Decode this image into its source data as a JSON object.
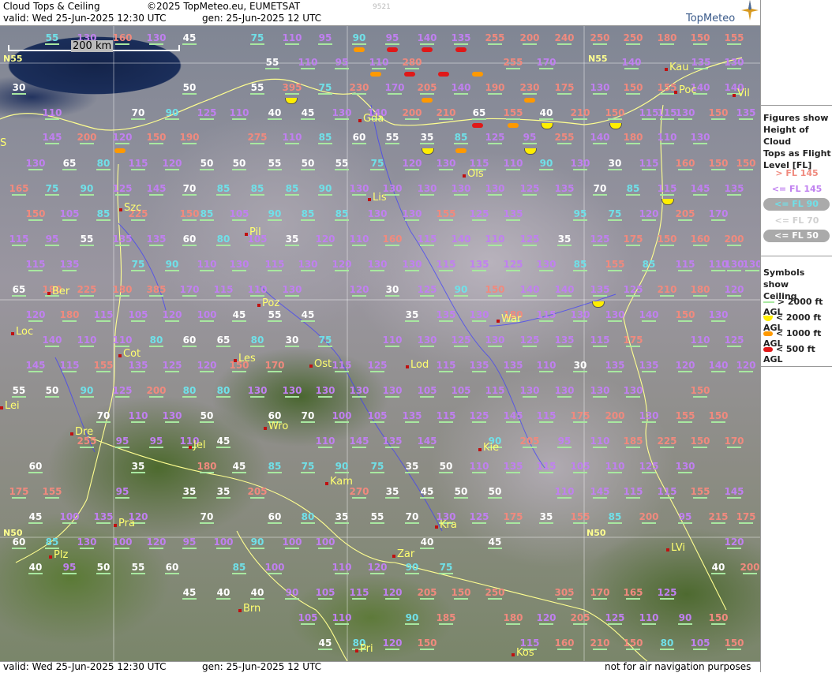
{
  "header": {
    "title": "Cloud Tops & Ceiling",
    "copyright": "©2025 TopMeteo.eu, EUMETSAT",
    "valid": "valid:  Wed  25-Jun-2025  12:30 UTC",
    "gen": "gen:  25-Jun-2025 12 UTC",
    "code": "9521",
    "logo": "TopMeteo"
  },
  "footer": {
    "valid": "valid:  Wed  25-Jun-2025  12:30 UTC",
    "gen": "gen:  25-Jun-2025 12 UTC",
    "disclaimer": "not for air navigation purposes"
  },
  "scale": "200 km",
  "colors": {
    "pink": "#f08a7e",
    "violet": "#c080f0",
    "cyan": "#70e0e8",
    "white": "#ffffff",
    "green_ok": "#a8e8a0",
    "yellow": "#ffee00",
    "orange": "#ff9900",
    "red": "#e01818"
  },
  "legend": {
    "figures_title": [
      "Figures show",
      "Height of Cloud",
      "Tops as Flight",
      "Level  [FL]"
    ],
    "items": [
      {
        "text": "> FL 145",
        "color": "#f08a7e",
        "style": "plain"
      },
      {
        "text": "<= FL 145",
        "color": "#c080f0",
        "style": "plain"
      },
      {
        "text": "<= FL 90",
        "color": "#70e0e8",
        "style": "pill"
      },
      {
        "text": "<= FL 70",
        "color": "#e8e8e8",
        "style": "plain"
      },
      {
        "text": "<= FL 50",
        "color": "#ffffff",
        "style": "pill"
      }
    ],
    "symbols_title": [
      "Symbols show",
      "Ceiling"
    ],
    "symbols": [
      {
        "text": "> 2000 ft AGL",
        "kind": "line"
      },
      {
        "text": "< 2000 ft AGL",
        "kind": "yellow"
      },
      {
        "text": "< 1000 ft AGL",
        "kind": "orange"
      },
      {
        "text": "< 500 ft AGL",
        "kind": "red"
      }
    ]
  },
  "latitudes": [
    "N55",
    "N55",
    "N50",
    "N50"
  ],
  "cities": [
    "Kau",
    "Poc",
    "Vil",
    "Gda",
    "Ols",
    "Lis",
    "Szc",
    "Pil",
    "Ber",
    "Poz",
    "War",
    "Loc",
    "Cot",
    "Les",
    "Ost",
    "Lod",
    "Lei",
    "Dre",
    "Wro",
    "Jel",
    "Kie",
    "Kam",
    "Pra",
    "Kra",
    "Plz",
    "Zar",
    "LVi",
    "Brn",
    "Pri",
    "Kos",
    "S"
  ],
  "values": [
    [
      "55",
      "c"
    ],
    [
      "130",
      "v"
    ],
    [
      "160",
      "p"
    ],
    [
      "130",
      "v"
    ],
    [
      "45",
      "w"
    ],
    [
      "75",
      "c"
    ],
    [
      "110",
      "v"
    ],
    [
      "95",
      "v"
    ],
    [
      "90",
      "c"
    ],
    [
      "95",
      "v"
    ],
    [
      "140",
      "v"
    ],
    [
      "135",
      "v"
    ],
    [
      "255",
      "p"
    ],
    [
      "200",
      "p"
    ],
    [
      "240",
      "p"
    ],
    [
      "250",
      "p"
    ],
    [
      "250",
      "p"
    ],
    [
      "180",
      "p"
    ],
    [
      "150",
      "p"
    ],
    [
      "155",
      "p"
    ],
    [
      "55",
      "w"
    ],
    [
      "110",
      "v"
    ],
    [
      "95",
      "v"
    ],
    [
      "110",
      "v"
    ],
    [
      "280",
      "p"
    ],
    [
      "255",
      "p"
    ],
    [
      "170",
      "v"
    ],
    [
      "140",
      "v"
    ],
    [
      "135",
      "v"
    ],
    [
      "130",
      "v"
    ],
    [
      "30",
      "w"
    ],
    [
      "50",
      "w"
    ],
    [
      "55",
      "w"
    ],
    [
      "395",
      "p"
    ],
    [
      "75",
      "c"
    ],
    [
      "230",
      "p"
    ],
    [
      "170",
      "v"
    ],
    [
      "205",
      "p"
    ],
    [
      "140",
      "v"
    ],
    [
      "190",
      "p"
    ],
    [
      "230",
      "p"
    ],
    [
      "175",
      "p"
    ],
    [
      "130",
      "v"
    ],
    [
      "150",
      "p"
    ],
    [
      "155",
      "p"
    ],
    [
      "140",
      "v"
    ],
    [
      "140",
      "v"
    ],
    [
      "110",
      "v"
    ],
    [
      "70",
      "w"
    ],
    [
      "90",
      "c"
    ],
    [
      "125",
      "v"
    ],
    [
      "110",
      "v"
    ],
    [
      "40",
      "w"
    ],
    [
      "45",
      "w"
    ],
    [
      "130",
      "v"
    ],
    [
      "140",
      "v"
    ],
    [
      "200",
      "p"
    ],
    [
      "210",
      "p"
    ],
    [
      "65",
      "w"
    ],
    [
      "155",
      "p"
    ],
    [
      "40",
      "w"
    ],
    [
      "210",
      "p"
    ],
    [
      "150",
      "p"
    ],
    [
      "115",
      "v"
    ],
    [
      "115",
      "v"
    ],
    [
      "130",
      "v"
    ],
    [
      "150",
      "p"
    ],
    [
      "135",
      "v"
    ],
    [
      "145",
      "v"
    ],
    [
      "200",
      "p"
    ],
    [
      "120",
      "v"
    ],
    [
      "150",
      "p"
    ],
    [
      "190",
      "p"
    ],
    [
      "275",
      "p"
    ],
    [
      "110",
      "v"
    ],
    [
      "85",
      "c"
    ],
    [
      "60",
      "w"
    ],
    [
      "55",
      "w"
    ],
    [
      "35",
      "w"
    ],
    [
      "85",
      "c"
    ],
    [
      "125",
      "v"
    ],
    [
      "95",
      "v"
    ],
    [
      "255",
      "p"
    ],
    [
      "140",
      "v"
    ],
    [
      "180",
      "p"
    ],
    [
      "110",
      "v"
    ],
    [
      "130",
      "v"
    ],
    [
      "130",
      "v"
    ],
    [
      "65",
      "w"
    ],
    [
      "80",
      "c"
    ],
    [
      "115",
      "v"
    ],
    [
      "120",
      "v"
    ],
    [
      "50",
      "w"
    ],
    [
      "50",
      "w"
    ],
    [
      "55",
      "w"
    ],
    [
      "50",
      "w"
    ],
    [
      "55",
      "w"
    ],
    [
      "75",
      "c"
    ],
    [
      "120",
      "v"
    ],
    [
      "130",
      "v"
    ],
    [
      "115",
      "v"
    ],
    [
      "110",
      "v"
    ],
    [
      "90",
      "c"
    ],
    [
      "130",
      "v"
    ],
    [
      "30",
      "w"
    ],
    [
      "115",
      "v"
    ],
    [
      "160",
      "p"
    ],
    [
      "150",
      "p"
    ],
    [
      "150",
      "p"
    ],
    [
      "165",
      "p"
    ],
    [
      "75",
      "c"
    ],
    [
      "90",
      "c"
    ],
    [
      "125",
      "v"
    ],
    [
      "145",
      "v"
    ],
    [
      "70",
      "w"
    ],
    [
      "85",
      "c"
    ],
    [
      "85",
      "c"
    ],
    [
      "85",
      "c"
    ],
    [
      "90",
      "c"
    ],
    [
      "130",
      "v"
    ],
    [
      "130",
      "v"
    ],
    [
      "130",
      "v"
    ],
    [
      "130",
      "v"
    ],
    [
      "130",
      "v"
    ],
    [
      "125",
      "v"
    ],
    [
      "135",
      "v"
    ],
    [
      "70",
      "w"
    ],
    [
      "85",
      "c"
    ],
    [
      "115",
      "v"
    ],
    [
      "145",
      "v"
    ],
    [
      "135",
      "v"
    ],
    [
      "150",
      "p"
    ],
    [
      "105",
      "v"
    ],
    [
      "85",
      "c"
    ],
    [
      "225",
      "p"
    ],
    [
      "150",
      "p"
    ],
    [
      "85",
      "c"
    ],
    [
      "105",
      "v"
    ],
    [
      "90",
      "c"
    ],
    [
      "85",
      "c"
    ],
    [
      "85",
      "c"
    ],
    [
      "130",
      "v"
    ],
    [
      "130",
      "v"
    ],
    [
      "155",
      "p"
    ],
    [
      "125",
      "v"
    ],
    [
      "135",
      "v"
    ],
    [
      "95",
      "c"
    ],
    [
      "75",
      "c"
    ],
    [
      "120",
      "v"
    ],
    [
      "205",
      "p"
    ],
    [
      "170",
      "v"
    ],
    [
      "115",
      "v"
    ],
    [
      "95",
      "v"
    ],
    [
      "55",
      "w"
    ],
    [
      "135",
      "v"
    ],
    [
      "135",
      "v"
    ],
    [
      "60",
      "w"
    ],
    [
      "80",
      "c"
    ],
    [
      "105",
      "v"
    ],
    [
      "35",
      "w"
    ],
    [
      "120",
      "v"
    ],
    [
      "110",
      "v"
    ],
    [
      "160",
      "p"
    ],
    [
      "115",
      "v"
    ],
    [
      "140",
      "v"
    ],
    [
      "110",
      "v"
    ],
    [
      "125",
      "v"
    ],
    [
      "35",
      "w"
    ],
    [
      "125",
      "v"
    ],
    [
      "175",
      "p"
    ],
    [
      "150",
      "p"
    ],
    [
      "160",
      "p"
    ],
    [
      "200",
      "p"
    ],
    [
      "115",
      "v"
    ],
    [
      "135",
      "v"
    ],
    [
      "75",
      "c"
    ],
    [
      "90",
      "c"
    ],
    [
      "110",
      "v"
    ],
    [
      "130",
      "v"
    ],
    [
      "115",
      "v"
    ],
    [
      "130",
      "v"
    ],
    [
      "120",
      "v"
    ],
    [
      "130",
      "v"
    ],
    [
      "130",
      "v"
    ],
    [
      "115",
      "v"
    ],
    [
      "135",
      "v"
    ],
    [
      "125",
      "v"
    ],
    [
      "130",
      "v"
    ],
    [
      "85",
      "c"
    ],
    [
      "155",
      "p"
    ],
    [
      "85",
      "c"
    ],
    [
      "115",
      "v"
    ],
    [
      "110",
      "v"
    ],
    [
      "130",
      "v"
    ],
    [
      "130",
      "v"
    ],
    [
      "65",
      "w"
    ],
    [
      "180",
      "p"
    ],
    [
      "225",
      "p"
    ],
    [
      "180",
      "p"
    ],
    [
      "385",
      "p"
    ],
    [
      "170",
      "v"
    ],
    [
      "115",
      "v"
    ],
    [
      "110",
      "v"
    ],
    [
      "130",
      "v"
    ],
    [
      "120",
      "v"
    ],
    [
      "30",
      "w"
    ],
    [
      "125",
      "v"
    ],
    [
      "90",
      "c"
    ],
    [
      "150",
      "p"
    ],
    [
      "140",
      "v"
    ],
    [
      "140",
      "v"
    ],
    [
      "135",
      "v"
    ],
    [
      "125",
      "v"
    ],
    [
      "210",
      "p"
    ],
    [
      "180",
      "p"
    ],
    [
      "120",
      "v"
    ],
    [
      "120",
      "v"
    ],
    [
      "180",
      "p"
    ],
    [
      "115",
      "v"
    ],
    [
      "105",
      "v"
    ],
    [
      "120",
      "v"
    ],
    [
      "100",
      "v"
    ],
    [
      "45",
      "w"
    ],
    [
      "55",
      "w"
    ],
    [
      "45",
      "w"
    ],
    [
      "35",
      "w"
    ],
    [
      "135",
      "v"
    ],
    [
      "130",
      "v"
    ],
    [
      "180",
      "p"
    ],
    [
      "115",
      "v"
    ],
    [
      "130",
      "v"
    ],
    [
      "130",
      "v"
    ],
    [
      "140",
      "v"
    ],
    [
      "150",
      "p"
    ],
    [
      "130",
      "v"
    ],
    [
      "140",
      "v"
    ],
    [
      "110",
      "v"
    ],
    [
      "110",
      "v"
    ],
    [
      "80",
      "c"
    ],
    [
      "60",
      "w"
    ],
    [
      "65",
      "w"
    ],
    [
      "80",
      "c"
    ],
    [
      "30",
      "w"
    ],
    [
      "75",
      "c"
    ],
    [
      "110",
      "v"
    ],
    [
      "130",
      "v"
    ],
    [
      "125",
      "v"
    ],
    [
      "130",
      "v"
    ],
    [
      "125",
      "v"
    ],
    [
      "135",
      "v"
    ],
    [
      "115",
      "v"
    ],
    [
      "175",
      "p"
    ],
    [
      "110",
      "v"
    ],
    [
      "125",
      "v"
    ],
    [
      "145",
      "v"
    ],
    [
      "115",
      "v"
    ],
    [
      "155",
      "p"
    ],
    [
      "135",
      "v"
    ],
    [
      "125",
      "v"
    ],
    [
      "120",
      "v"
    ],
    [
      "150",
      "p"
    ],
    [
      "170",
      "p"
    ],
    [
      "115",
      "v"
    ],
    [
      "125",
      "v"
    ],
    [
      "115",
      "v"
    ],
    [
      "135",
      "v"
    ],
    [
      "135",
      "v"
    ],
    [
      "110",
      "v"
    ],
    [
      "30",
      "w"
    ],
    [
      "135",
      "v"
    ],
    [
      "135",
      "v"
    ],
    [
      "120",
      "v"
    ],
    [
      "140",
      "v"
    ],
    [
      "120",
      "v"
    ],
    [
      "55",
      "w"
    ],
    [
      "50",
      "w"
    ],
    [
      "90",
      "c"
    ],
    [
      "125",
      "v"
    ],
    [
      "200",
      "p"
    ],
    [
      "80",
      "c"
    ],
    [
      "80",
      "c"
    ],
    [
      "130",
      "v"
    ],
    [
      "130",
      "v"
    ],
    [
      "130",
      "v"
    ],
    [
      "130",
      "v"
    ],
    [
      "130",
      "v"
    ],
    [
      "105",
      "v"
    ],
    [
      "105",
      "v"
    ],
    [
      "115",
      "v"
    ],
    [
      "130",
      "v"
    ],
    [
      "130",
      "v"
    ],
    [
      "130",
      "v"
    ],
    [
      "130",
      "v"
    ],
    [
      "150",
      "p"
    ],
    [
      "70",
      "w"
    ],
    [
      "110",
      "v"
    ],
    [
      "130",
      "v"
    ],
    [
      "50",
      "w"
    ],
    [
      "60",
      "w"
    ],
    [
      "70",
      "w"
    ],
    [
      "100",
      "v"
    ],
    [
      "105",
      "v"
    ],
    [
      "135",
      "v"
    ],
    [
      "115",
      "v"
    ],
    [
      "125",
      "v"
    ],
    [
      "145",
      "v"
    ],
    [
      "115",
      "v"
    ],
    [
      "175",
      "p"
    ],
    [
      "200",
      "p"
    ],
    [
      "130",
      "v"
    ],
    [
      "155",
      "p"
    ],
    [
      "150",
      "p"
    ],
    [
      "255",
      "p"
    ],
    [
      "95",
      "v"
    ],
    [
      "95",
      "v"
    ],
    [
      "110",
      "v"
    ],
    [
      "45",
      "w"
    ],
    [
      "110",
      "v"
    ],
    [
      "145",
      "v"
    ],
    [
      "135",
      "v"
    ],
    [
      "145",
      "v"
    ],
    [
      "90",
      "c"
    ],
    [
      "205",
      "p"
    ],
    [
      "95",
      "v"
    ],
    [
      "110",
      "v"
    ],
    [
      "185",
      "p"
    ],
    [
      "225",
      "p"
    ],
    [
      "150",
      "p"
    ],
    [
      "170",
      "p"
    ],
    [
      "60",
      "w"
    ],
    [
      "35",
      "w"
    ],
    [
      "180",
      "p"
    ],
    [
      "45",
      "w"
    ],
    [
      "85",
      "c"
    ],
    [
      "75",
      "c"
    ],
    [
      "90",
      "c"
    ],
    [
      "75",
      "c"
    ],
    [
      "35",
      "w"
    ],
    [
      "50",
      "w"
    ],
    [
      "110",
      "v"
    ],
    [
      "135",
      "v"
    ],
    [
      "115",
      "v"
    ],
    [
      "105",
      "v"
    ],
    [
      "110",
      "v"
    ],
    [
      "125",
      "v"
    ],
    [
      "130",
      "v"
    ],
    [
      "175",
      "p"
    ],
    [
      "155",
      "p"
    ],
    [
      "95",
      "v"
    ],
    [
      "35",
      "w"
    ],
    [
      "35",
      "w"
    ],
    [
      "205",
      "p"
    ],
    [
      "270",
      "p"
    ],
    [
      "35",
      "w"
    ],
    [
      "45",
      "w"
    ],
    [
      "50",
      "w"
    ],
    [
      "50",
      "w"
    ],
    [
      "110",
      "v"
    ],
    [
      "145",
      "v"
    ],
    [
      "115",
      "v"
    ],
    [
      "115",
      "v"
    ],
    [
      "155",
      "p"
    ],
    [
      "145",
      "v"
    ],
    [
      "45",
      "w"
    ],
    [
      "100",
      "v"
    ],
    [
      "135",
      "v"
    ],
    [
      "120",
      "v"
    ],
    [
      "70",
      "w"
    ],
    [
      "60",
      "w"
    ],
    [
      "80",
      "c"
    ],
    [
      "35",
      "w"
    ],
    [
      "55",
      "w"
    ],
    [
      "70",
      "w"
    ],
    [
      "130",
      "v"
    ],
    [
      "125",
      "v"
    ],
    [
      "175",
      "p"
    ],
    [
      "35",
      "w"
    ],
    [
      "155",
      "p"
    ],
    [
      "85",
      "c"
    ],
    [
      "200",
      "p"
    ],
    [
      "95",
      "v"
    ],
    [
      "215",
      "p"
    ],
    [
      "175",
      "p"
    ],
    [
      "60",
      "w"
    ],
    [
      "85",
      "c"
    ],
    [
      "130",
      "v"
    ],
    [
      "100",
      "v"
    ],
    [
      "120",
      "v"
    ],
    [
      "95",
      "v"
    ],
    [
      "100",
      "v"
    ],
    [
      "90",
      "c"
    ],
    [
      "100",
      "v"
    ],
    [
      "100",
      "v"
    ],
    [
      "40",
      "w"
    ],
    [
      "45",
      "w"
    ],
    [
      "120",
      "v"
    ],
    [
      "40",
      "w"
    ],
    [
      "95",
      "v"
    ],
    [
      "50",
      "w"
    ],
    [
      "55",
      "w"
    ],
    [
      "60",
      "w"
    ],
    [
      "85",
      "c"
    ],
    [
      "100",
      "v"
    ],
    [
      "110",
      "v"
    ],
    [
      "120",
      "v"
    ],
    [
      "90",
      "c"
    ],
    [
      "75",
      "c"
    ],
    [
      "40",
      "w"
    ],
    [
      "200",
      "p"
    ],
    [
      "45",
      "w"
    ],
    [
      "40",
      "w"
    ],
    [
      "40",
      "w"
    ],
    [
      "90",
      "v"
    ],
    [
      "105",
      "v"
    ],
    [
      "115",
      "v"
    ],
    [
      "120",
      "v"
    ],
    [
      "205",
      "p"
    ],
    [
      "150",
      "p"
    ],
    [
      "250",
      "p"
    ],
    [
      "305",
      "p"
    ],
    [
      "170",
      "p"
    ],
    [
      "165",
      "p"
    ],
    [
      "125",
      "v"
    ],
    [
      "105",
      "v"
    ],
    [
      "110",
      "v"
    ],
    [
      "90",
      "c"
    ],
    [
      "185",
      "p"
    ],
    [
      "180",
      "p"
    ],
    [
      "120",
      "v"
    ],
    [
      "205",
      "p"
    ],
    [
      "125",
      "v"
    ],
    [
      "110",
      "v"
    ],
    [
      "90",
      "v"
    ],
    [
      "150",
      "p"
    ],
    [
      "45",
      "w"
    ],
    [
      "80",
      "c"
    ],
    [
      "120",
      "v"
    ],
    [
      "150",
      "p"
    ],
    [
      "115",
      "v"
    ],
    [
      "160",
      "p"
    ],
    [
      "210",
      "p"
    ],
    [
      "150",
      "p"
    ],
    [
      "80",
      "c"
    ],
    [
      "105",
      "v"
    ],
    [
      "150",
      "p"
    ]
  ]
}
